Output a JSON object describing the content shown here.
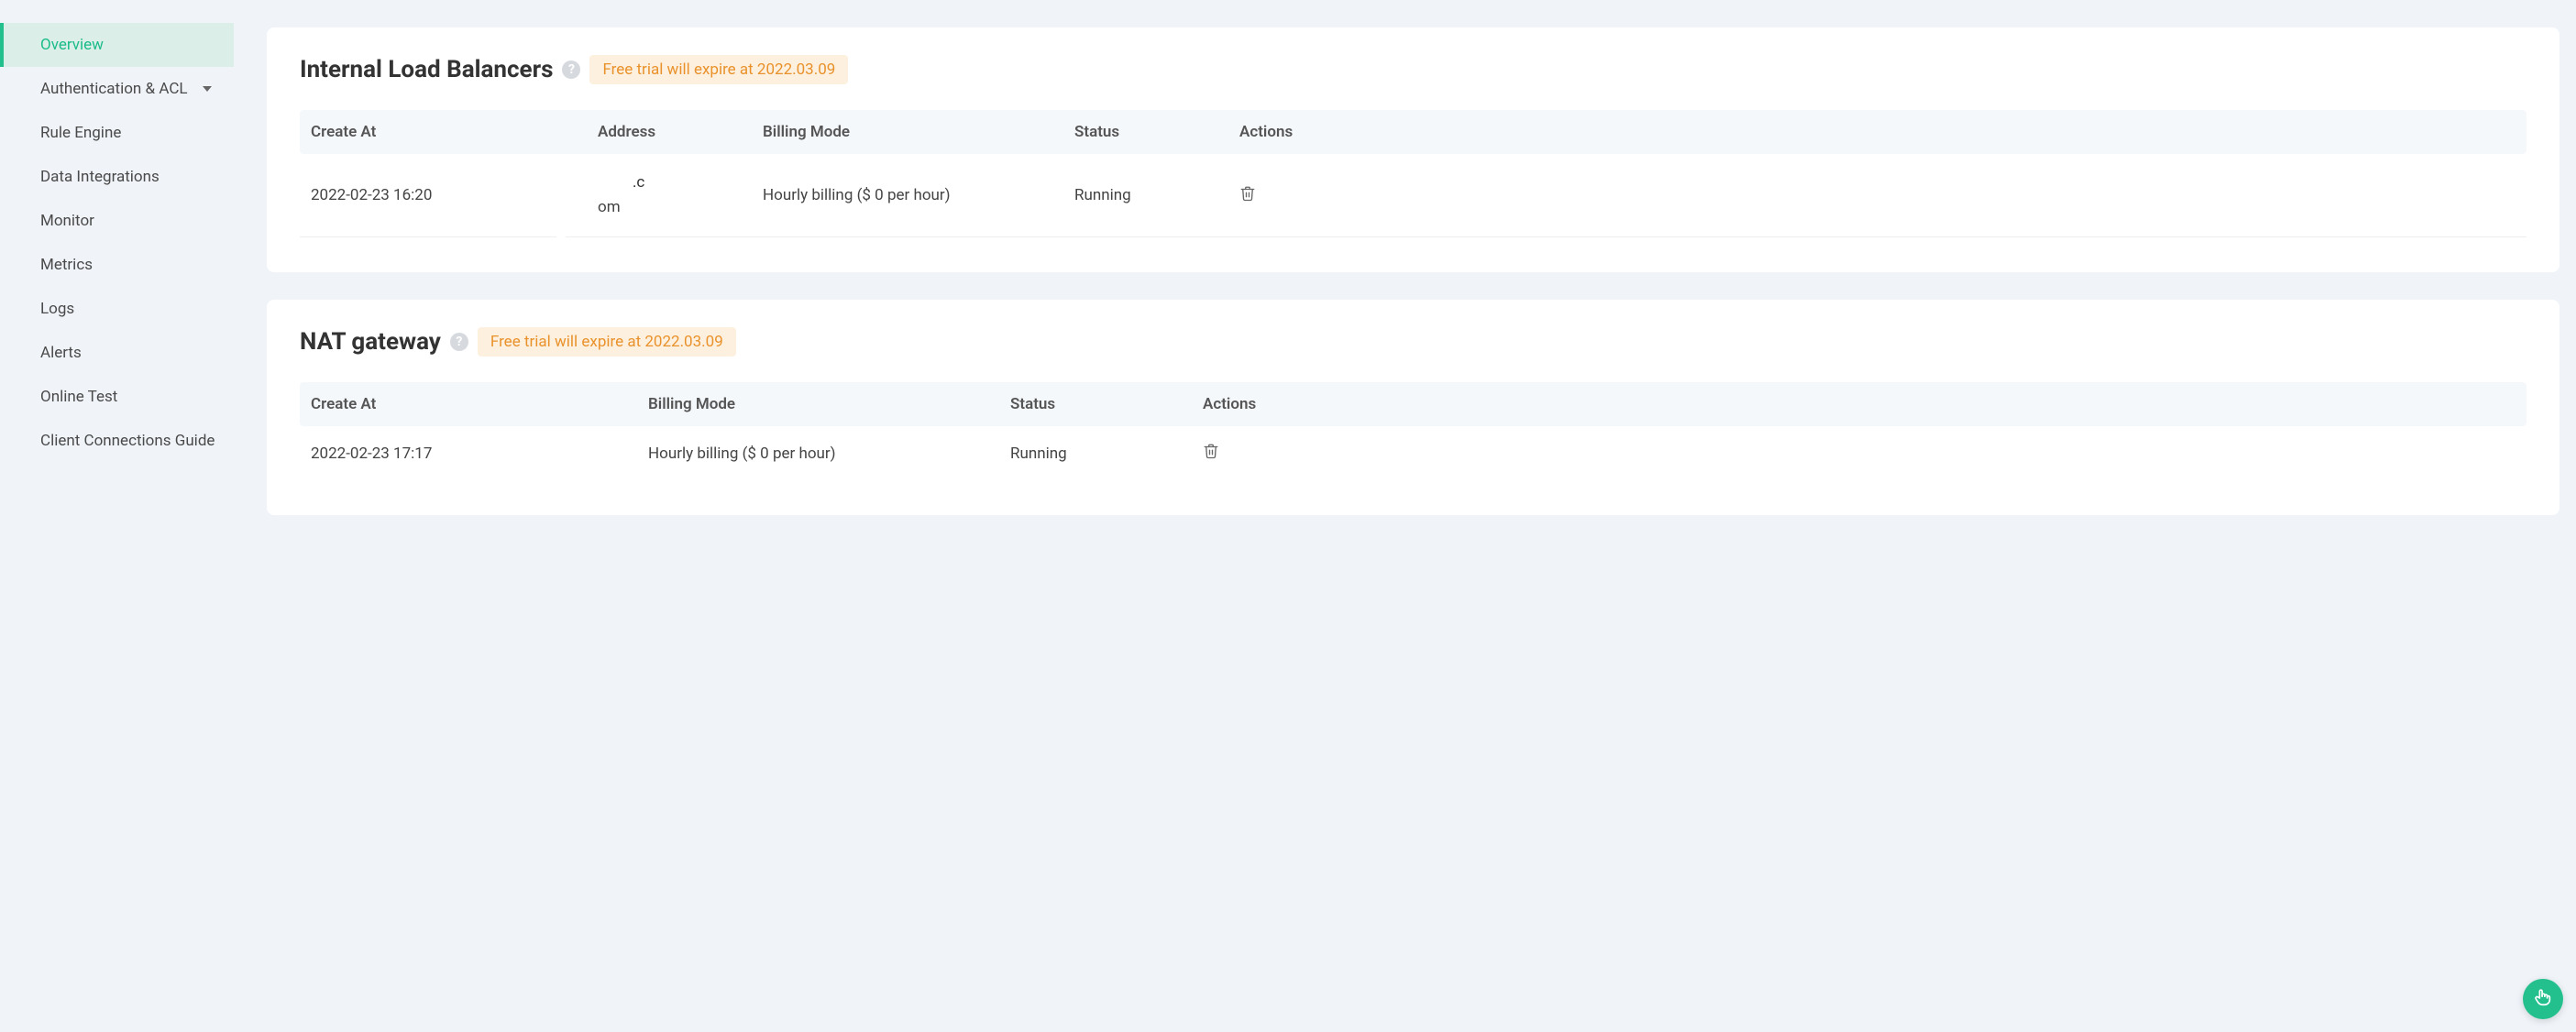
{
  "sidebar": {
    "items": [
      {
        "label": "Overview",
        "active": true
      },
      {
        "label": "Authentication & ACL",
        "expandable": true
      },
      {
        "label": "Rule Engine"
      },
      {
        "label": "Data Integrations"
      },
      {
        "label": "Monitor"
      },
      {
        "label": "Metrics"
      },
      {
        "label": "Logs"
      },
      {
        "label": "Alerts"
      },
      {
        "label": "Online Test"
      },
      {
        "label": "Client Connections Guide"
      }
    ]
  },
  "trial_message": "Free trial will expire at 2022.03.09",
  "ilb": {
    "title": "Internal Load Balancers",
    "columns": [
      "Create At",
      "Address",
      "Billing Mode",
      "Status",
      "Actions"
    ],
    "row": {
      "created_at": "2022-02-23 16:20",
      "address": "om",
      "billing": "Hourly billing ($ 0 per hour)",
      "status": "Running"
    }
  },
  "nat": {
    "title": "NAT gateway",
    "columns": [
      "Create At",
      "Billing Mode",
      "Status",
      "Actions"
    ],
    "row": {
      "created_at": "2022-02-23 17:17",
      "billing": "Hourly billing ($ 0 per hour)",
      "status": "Running"
    }
  }
}
